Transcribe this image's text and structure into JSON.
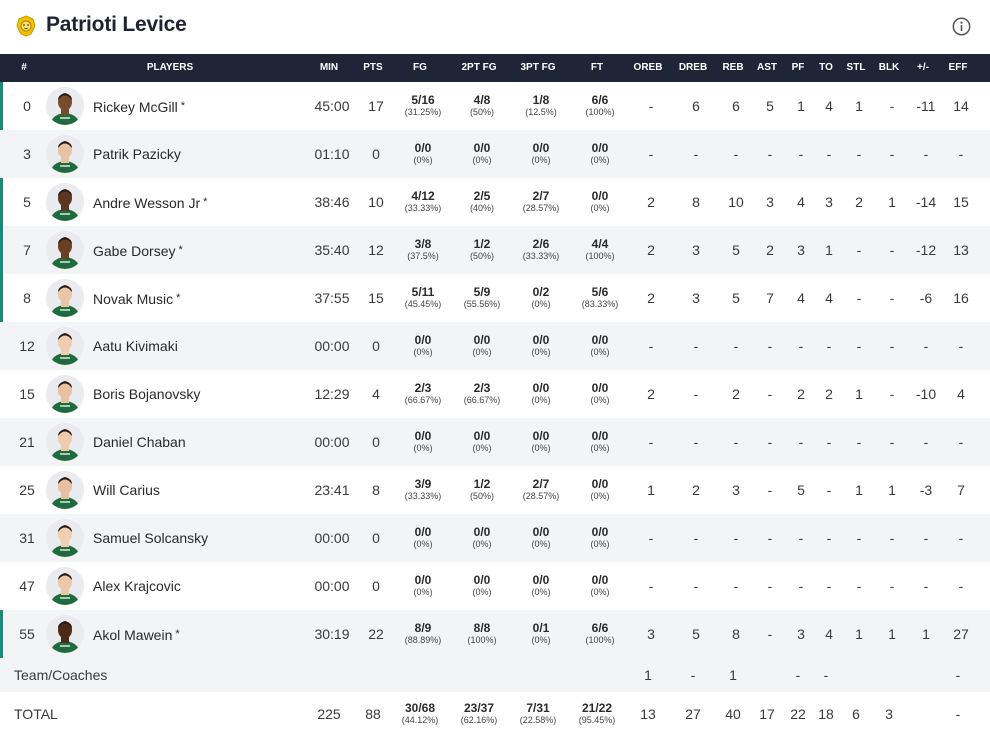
{
  "header": {
    "team_name": "Patrioti Levice",
    "logo_icon": "lion-icon",
    "info_icon": "info-icon"
  },
  "columns": [
    "#",
    "PLAYERS",
    "MIN",
    "PTS",
    "FG",
    "2PT FG",
    "3PT FG",
    "FT",
    "OREB",
    "DREB",
    "REB",
    "AST",
    "PF",
    "TO",
    "STL",
    "BLK",
    "+/-",
    "EFF"
  ],
  "colors": {
    "header_bg": "#1e2537",
    "starter_accent": "#1c8a78",
    "alt_row_bg": "#f3f4f6",
    "jersey_green": "#1f6b3e"
  },
  "players": [
    {
      "number": "0",
      "name": "Rickey McGill",
      "starter": true,
      "min": "45:00",
      "pts": "17",
      "fg": {
        "m": "5/16",
        "p": "(31.25%)"
      },
      "fg2": {
        "m": "4/8",
        "p": "(50%)"
      },
      "fg3": {
        "m": "1/8",
        "p": "(12.5%)"
      },
      "ft": {
        "m": "6/6",
        "p": "(100%)"
      },
      "oreb": "-",
      "dreb": "6",
      "reb": "6",
      "ast": "5",
      "pf": "1",
      "to": "4",
      "stl": "1",
      "blk": "-",
      "pm": "-11",
      "eff": "14"
    },
    {
      "number": "3",
      "name": "Patrik Pazicky",
      "starter": false,
      "min": "01:10",
      "pts": "0",
      "fg": {
        "m": "0/0",
        "p": "(0%)"
      },
      "fg2": {
        "m": "0/0",
        "p": "(0%)"
      },
      "fg3": {
        "m": "0/0",
        "p": "(0%)"
      },
      "ft": {
        "m": "0/0",
        "p": "(0%)"
      },
      "oreb": "-",
      "dreb": "-",
      "reb": "-",
      "ast": "-",
      "pf": "-",
      "to": "-",
      "stl": "-",
      "blk": "-",
      "pm": "-",
      "eff": "-"
    },
    {
      "number": "5",
      "name": "Andre Wesson Jr",
      "starter": true,
      "min": "38:46",
      "pts": "10",
      "fg": {
        "m": "4/12",
        "p": "(33.33%)"
      },
      "fg2": {
        "m": "2/5",
        "p": "(40%)"
      },
      "fg3": {
        "m": "2/7",
        "p": "(28.57%)"
      },
      "ft": {
        "m": "0/0",
        "p": "(0%)"
      },
      "oreb": "2",
      "dreb": "8",
      "reb": "10",
      "ast": "3",
      "pf": "4",
      "to": "3",
      "stl": "2",
      "blk": "1",
      "pm": "-14",
      "eff": "15"
    },
    {
      "number": "7",
      "name": "Gabe Dorsey",
      "starter": true,
      "min": "35:40",
      "pts": "12",
      "fg": {
        "m": "3/8",
        "p": "(37.5%)"
      },
      "fg2": {
        "m": "1/2",
        "p": "(50%)"
      },
      "fg3": {
        "m": "2/6",
        "p": "(33.33%)"
      },
      "ft": {
        "m": "4/4",
        "p": "(100%)"
      },
      "oreb": "2",
      "dreb": "3",
      "reb": "5",
      "ast": "2",
      "pf": "3",
      "to": "1",
      "stl": "-",
      "blk": "-",
      "pm": "-12",
      "eff": "13"
    },
    {
      "number": "8",
      "name": "Novak Music",
      "starter": true,
      "min": "37:55",
      "pts": "15",
      "fg": {
        "m": "5/11",
        "p": "(45.45%)"
      },
      "fg2": {
        "m": "5/9",
        "p": "(55.56%)"
      },
      "fg3": {
        "m": "0/2",
        "p": "(0%)"
      },
      "ft": {
        "m": "5/6",
        "p": "(83.33%)"
      },
      "oreb": "2",
      "dreb": "3",
      "reb": "5",
      "ast": "7",
      "pf": "4",
      "to": "4",
      "stl": "-",
      "blk": "-",
      "pm": "-6",
      "eff": "16"
    },
    {
      "number": "12",
      "name": "Aatu Kivimaki",
      "starter": false,
      "min": "00:00",
      "pts": "0",
      "fg": {
        "m": "0/0",
        "p": "(0%)"
      },
      "fg2": {
        "m": "0/0",
        "p": "(0%)"
      },
      "fg3": {
        "m": "0/0",
        "p": "(0%)"
      },
      "ft": {
        "m": "0/0",
        "p": "(0%)"
      },
      "oreb": "-",
      "dreb": "-",
      "reb": "-",
      "ast": "-",
      "pf": "-",
      "to": "-",
      "stl": "-",
      "blk": "-",
      "pm": "-",
      "eff": "-"
    },
    {
      "number": "15",
      "name": "Boris Bojanovsky",
      "starter": false,
      "min": "12:29",
      "pts": "4",
      "fg": {
        "m": "2/3",
        "p": "(66.67%)"
      },
      "fg2": {
        "m": "2/3",
        "p": "(66.67%)"
      },
      "fg3": {
        "m": "0/0",
        "p": "(0%)"
      },
      "ft": {
        "m": "0/0",
        "p": "(0%)"
      },
      "oreb": "2",
      "dreb": "-",
      "reb": "2",
      "ast": "-",
      "pf": "2",
      "to": "2",
      "stl": "1",
      "blk": "-",
      "pm": "-10",
      "eff": "4"
    },
    {
      "number": "21",
      "name": "Daniel Chaban",
      "starter": false,
      "min": "00:00",
      "pts": "0",
      "fg": {
        "m": "0/0",
        "p": "(0%)"
      },
      "fg2": {
        "m": "0/0",
        "p": "(0%)"
      },
      "fg3": {
        "m": "0/0",
        "p": "(0%)"
      },
      "ft": {
        "m": "0/0",
        "p": "(0%)"
      },
      "oreb": "-",
      "dreb": "-",
      "reb": "-",
      "ast": "-",
      "pf": "-",
      "to": "-",
      "stl": "-",
      "blk": "-",
      "pm": "-",
      "eff": "-"
    },
    {
      "number": "25",
      "name": "Will Carius",
      "starter": false,
      "min": "23:41",
      "pts": "8",
      "fg": {
        "m": "3/9",
        "p": "(33.33%)"
      },
      "fg2": {
        "m": "1/2",
        "p": "(50%)"
      },
      "fg3": {
        "m": "2/7",
        "p": "(28.57%)"
      },
      "ft": {
        "m": "0/0",
        "p": "(0%)"
      },
      "oreb": "1",
      "dreb": "2",
      "reb": "3",
      "ast": "-",
      "pf": "5",
      "to": "-",
      "stl": "1",
      "blk": "1",
      "pm": "-3",
      "eff": "7"
    },
    {
      "number": "31",
      "name": "Samuel Solcansky",
      "starter": false,
      "min": "00:00",
      "pts": "0",
      "fg": {
        "m": "0/0",
        "p": "(0%)"
      },
      "fg2": {
        "m": "0/0",
        "p": "(0%)"
      },
      "fg3": {
        "m": "0/0",
        "p": "(0%)"
      },
      "ft": {
        "m": "0/0",
        "p": "(0%)"
      },
      "oreb": "-",
      "dreb": "-",
      "reb": "-",
      "ast": "-",
      "pf": "-",
      "to": "-",
      "stl": "-",
      "blk": "-",
      "pm": "-",
      "eff": "-"
    },
    {
      "number": "47",
      "name": "Alex Krajcovic",
      "starter": false,
      "min": "00:00",
      "pts": "0",
      "fg": {
        "m": "0/0",
        "p": "(0%)"
      },
      "fg2": {
        "m": "0/0",
        "p": "(0%)"
      },
      "fg3": {
        "m": "0/0",
        "p": "(0%)"
      },
      "ft": {
        "m": "0/0",
        "p": "(0%)"
      },
      "oreb": "-",
      "dreb": "-",
      "reb": "-",
      "ast": "-",
      "pf": "-",
      "to": "-",
      "stl": "-",
      "blk": "-",
      "pm": "-",
      "eff": "-"
    },
    {
      "number": "55",
      "name": "Akol Mawein",
      "starter": true,
      "min": "30:19",
      "pts": "22",
      "fg": {
        "m": "8/9",
        "p": "(88.89%)"
      },
      "fg2": {
        "m": "8/8",
        "p": "(100%)"
      },
      "fg3": {
        "m": "0/1",
        "p": "(0%)"
      },
      "ft": {
        "m": "6/6",
        "p": "(100%)"
      },
      "oreb": "3",
      "dreb": "5",
      "reb": "8",
      "ast": "-",
      "pf": "3",
      "to": "4",
      "stl": "1",
      "blk": "1",
      "pm": "1",
      "eff": "27"
    }
  ],
  "team_coaches": {
    "label": "Team/Coaches",
    "oreb": "1",
    "dreb": "-",
    "reb": "1",
    "ast": "",
    "pf": "-",
    "to": "-",
    "stl": "",
    "blk": "",
    "pm": "",
    "eff": "-"
  },
  "total": {
    "label": "TOTAL",
    "min": "225",
    "pts": "88",
    "fg": {
      "m": "30/68",
      "p": "(44.12%)"
    },
    "fg2": {
      "m": "23/37",
      "p": "(62.16%)"
    },
    "fg3": {
      "m": "7/31",
      "p": "(22.58%)"
    },
    "ft": {
      "m": "21/22",
      "p": "(95.45%)"
    },
    "oreb": "13",
    "dreb": "27",
    "reb": "40",
    "ast": "17",
    "pf": "22",
    "to": "18",
    "stl": "6",
    "blk": "3",
    "pm": "",
    "eff": "-"
  }
}
